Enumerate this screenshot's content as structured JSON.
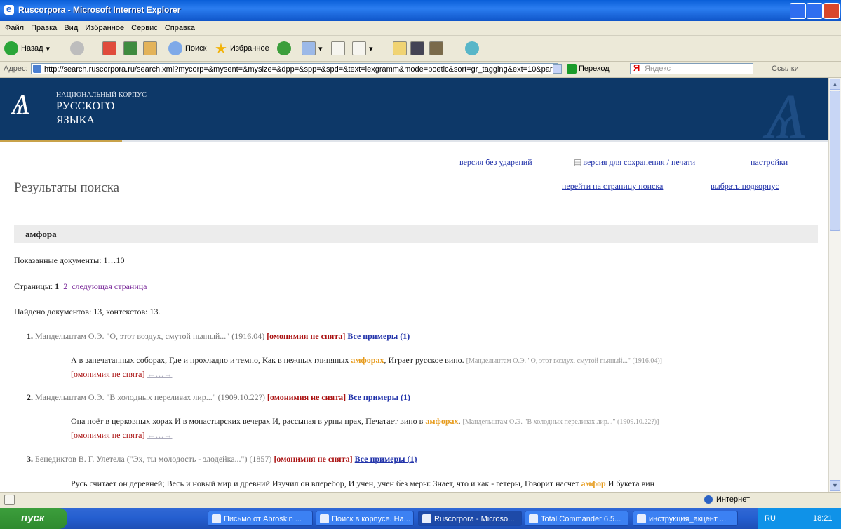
{
  "window": {
    "title": "Ruscorpora - Microsoft Internet Explorer"
  },
  "menu": [
    "Файл",
    "Правка",
    "Вид",
    "Избранное",
    "Сервис",
    "Справка"
  ],
  "toolbar": {
    "back": "Назад",
    "search": "Поиск",
    "favorites": "Избранное"
  },
  "address": {
    "label": "Адрес:",
    "url": "http://search.ruscorpora.ru/search.xml?mycorp=&mysent=&mysize=&dpp=&spp=&spd=&text=lexgramm&mode=poetic&sort=gr_tagging&ext=10&parent1",
    "go": "Переход",
    "yandex_placeholder": "Яндекс",
    "links": "Ссылки"
  },
  "banner": {
    "line1": "НАЦИОНАЛЬНЫЙ КОРПУС",
    "line2": "РУССКОГО",
    "line3": "ЯЗЫКА"
  },
  "toplinks": {
    "no_accents": "версия без ударений",
    "print": "версия для сохранения / печати",
    "settings": "настройки",
    "search_page": "перейти на страницу поиска",
    "subcorpus": "выбрать подкорпус"
  },
  "page": {
    "heading": "Результаты поиска",
    "query": "амфора",
    "shown": "Показанные документы: 1…10",
    "pages_label": "Страницы:",
    "page_current": "1",
    "page_2": "2",
    "next": "следующая страница",
    "found": "Найдено документов: 13, контекстов: 13."
  },
  "results": [
    {
      "num": "1.",
      "title": "Мандельштам О.Э. \"О, этот воздух, смутой пьяный...\" (1916.04)",
      "hom": "[омонимия не снята]",
      "all": "Все примеры (1)",
      "pre": "А в запечатанных соборах, Где и прохладно и темно, Как в нежных глиняных",
      "hit": "амфорах",
      "post": ", Играет русское вино.",
      "src": "[Мандельштам О.Э. \"О, этот воздух, смутой пьяный...\" (1916.04)]",
      "hom2": "[омонимия не снята]",
      "arrows": "←…→"
    },
    {
      "num": "2.",
      "title": "Мандельштам О.Э. \"В холодных переливах лир...\" (1909.10.22?)",
      "hom": "[омонимия не снята]",
      "all": "Все примеры (1)",
      "pre": "Она поёт в церковных хорах И в монастырских вечерах И, рассыпая в урны прах, Печатает вино в",
      "hit": "амфорах",
      "post": ".",
      "src": "[Мандельштам О.Э. \"В холодных переливах лир...\" (1909.10.22?)]",
      "hom2": "[омонимия не снята]",
      "arrows": "←…→"
    },
    {
      "num": "3.",
      "title": "Бенедиктов В. Г. Улетела (\"Эх, ты молодость - злодейка...\") (1857)",
      "hom": "[омонимия не снята]",
      "all": "Все примеры (1)",
      "pre": "Русь считает он деревней; Весь и новый мир и древний Изучил он вперебор, И учен, учен без меры: Знает, что и как - гетеры, Говорит насчет",
      "hit": "амфор",
      "post": "И букета вин"
    }
  ],
  "status": {
    "zone": "Интернет"
  },
  "taskbar": {
    "start": "пуск",
    "tasks": [
      "Письмо от Abroskin ...",
      "Поиск в корпусе. На...",
      "Ruscorpora - Microso...",
      "Total Commander 6.5...",
      "инструкция_акцент ..."
    ],
    "lang": "RU",
    "time": "18:21"
  }
}
